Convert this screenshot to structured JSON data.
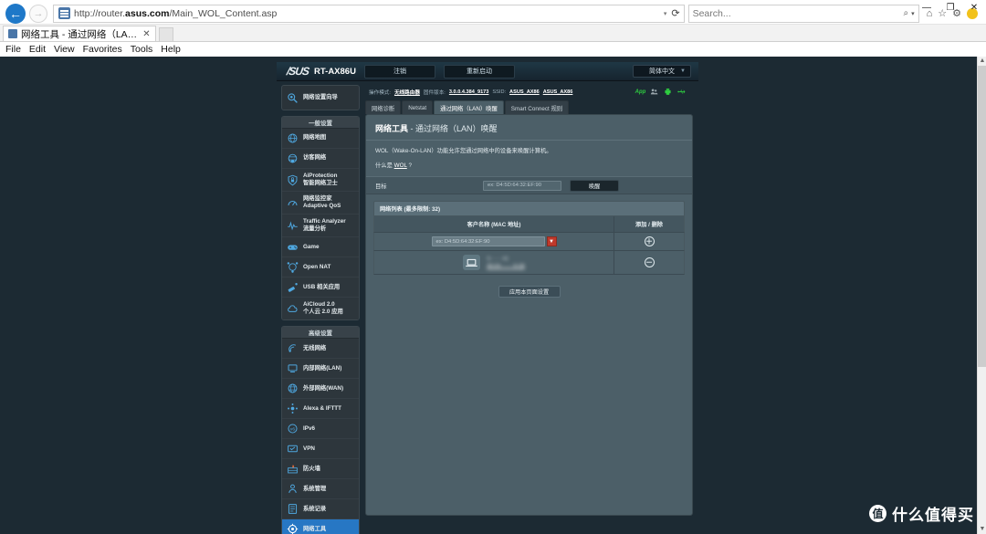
{
  "browser": {
    "url_prefix": "http://router.",
    "url_bold": "asus.com",
    "url_suffix": "/Main_WOL_Content.asp",
    "search_placeholder": "Search...",
    "tab_title": "网络工具 - 通过网络（LA…",
    "tab_close": "✕",
    "menu": [
      "File",
      "Edit",
      "View",
      "Favorites",
      "Tools",
      "Help"
    ],
    "window_buttons": {
      "minimize": "—",
      "maximize": "❐",
      "close": "✕"
    },
    "back_glyph": "←",
    "forward_glyph": "→",
    "reload_glyph": "⟳",
    "caret_glyph": "▾",
    "search_glyph": "⌕",
    "home_glyph": "⌂",
    "star_glyph": "☆",
    "gear_glyph": "⚙"
  },
  "router": {
    "brand": "/SUS",
    "model": "RT-AX86U",
    "logout_label": "注销",
    "reboot_label": "重新启动",
    "language": "简体中文",
    "lang_caret": "▼",
    "status": {
      "mode_label": "操作模式:",
      "mode_value": "无线路由器",
      "fw_label": "固件版本:",
      "fw_value": "3.0.0.4.384_9173",
      "ssid_label": "SSID:",
      "ssid_24": "ASUS_AX86",
      "ssid_5": "ASUS_AX86",
      "app_label": "App"
    },
    "sidebar": {
      "wizard_label": "网络设置向导",
      "general_header": "一般设置",
      "general_items": [
        {
          "label": "网络地图",
          "icon": "network-map-icon"
        },
        {
          "label": "访客网络",
          "icon": "guest-network-icon"
        },
        {
          "label": "AiProtection\n智能网络卫士",
          "icon": "shield-icon"
        },
        {
          "label": "网络监控家 Adaptive QoS",
          "icon": "qos-icon"
        },
        {
          "label": "Traffic Analyzer\n流量分析",
          "icon": "traffic-icon"
        },
        {
          "label": "Game",
          "icon": "gamepad-icon"
        },
        {
          "label": "Open NAT",
          "icon": "opennat-icon"
        },
        {
          "label": "USB 相关应用",
          "icon": "usb-icon"
        },
        {
          "label": "AiCloud 2.0\n个人云 2.0 应用",
          "icon": "cloud-icon"
        }
      ],
      "advanced_header": "高级设置",
      "advanced_items": [
        {
          "label": "无线网络",
          "icon": "wifi-icon"
        },
        {
          "label": "内部网络(LAN)",
          "icon": "lan-icon"
        },
        {
          "label": "外部网络(WAN)",
          "icon": "wan-icon"
        },
        {
          "label": "Alexa & IFTTT",
          "icon": "alexa-icon"
        },
        {
          "label": "IPv6",
          "icon": "ipv6-icon"
        },
        {
          "label": "VPN",
          "icon": "vpn-icon"
        },
        {
          "label": "防火墙",
          "icon": "firewall-icon"
        },
        {
          "label": "系统管理",
          "icon": "admin-icon"
        },
        {
          "label": "系统记录",
          "icon": "syslog-icon"
        },
        {
          "label": "网络工具",
          "icon": "tools-icon",
          "active": true
        }
      ]
    },
    "tabs": [
      {
        "label": "网络诊断",
        "active": false
      },
      {
        "label": "Netstat",
        "active": false
      },
      {
        "label": "通过网络（LAN）唤醒",
        "active": true
      },
      {
        "label": "Smart Connect 规则",
        "active": false
      }
    ],
    "content": {
      "title_main": "网络工具",
      "title_sub": "- 通过网络（LAN）唤醒",
      "description": "WOL（Wake-On-LAN）功能允许您通过网络中的设备来唤醒计算机。",
      "faq_prefix": "什么是 ",
      "faq_link": "WOL",
      "faq_suffix": " ?",
      "target_label": "目标",
      "target_placeholder": "ex: D4:5D:64:32:EF:90",
      "wake_button": "唤醒",
      "list_header": "网络列表 (最多限制: 32)",
      "col_client": "客户名称 (MAC 地址)",
      "col_action": "添加 / 删除",
      "mac_placeholder": "ex: D4:5D:64:32:EF:90",
      "mac_dropdown_caret": "▼",
      "add_glyph": "＋",
      "remove_glyph": "－",
      "rows": [
        {
          "name": "S·······41",
          "mac": "30:24:·······6:1B",
          "icon": "laptop-icon"
        }
      ],
      "apply_button": "应用本页面设置"
    }
  },
  "watermark": {
    "badge": "值",
    "text": "什么值得买"
  }
}
